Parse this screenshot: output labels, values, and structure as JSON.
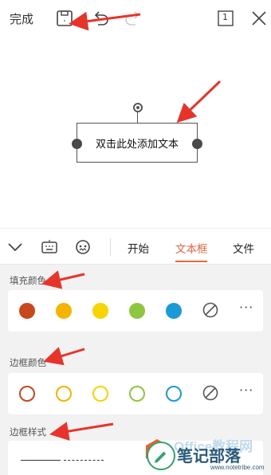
{
  "toolbar": {
    "done_label": "完成",
    "page_count": "1",
    "icons": [
      "save-icon",
      "undo-icon",
      "redo-icon",
      "page-count-icon",
      "close-icon"
    ]
  },
  "textbox": {
    "placeholder_text": "双击此处添加文本"
  },
  "tabbar": {
    "icons": [
      "collapse-chevron-icon",
      "keyboard-icon",
      "voice-assistant-icon"
    ],
    "tabs": [
      {
        "label": "开始",
        "active": false
      },
      {
        "label": "文本框",
        "active": true
      },
      {
        "label": "文件",
        "active": false
      }
    ]
  },
  "fill_color": {
    "label": "填充颜色",
    "swatches": [
      "#c8481c",
      "#f5b400",
      "#f8d400",
      "#8dc63f",
      "#1a9ad6"
    ],
    "none_icon": "no-color-icon",
    "more_label": "···"
  },
  "border_color": {
    "label": "边框颜色",
    "swatches": [
      "#c8481c",
      "#f5b400",
      "#f8d400",
      "#8dc63f",
      "#1a9ad6"
    ],
    "none_icon": "no-color-icon",
    "more_label": "···"
  },
  "border_style": {
    "label": "边框样式",
    "styles": [
      "solid",
      "dashed"
    ]
  },
  "watermark": {
    "brand": "Office教程网",
    "site_name": "笔记部落",
    "url": "www.notetribe.com"
  },
  "colors": {
    "accent": "#e9643f",
    "annotation_arrow": "#e8332b"
  }
}
